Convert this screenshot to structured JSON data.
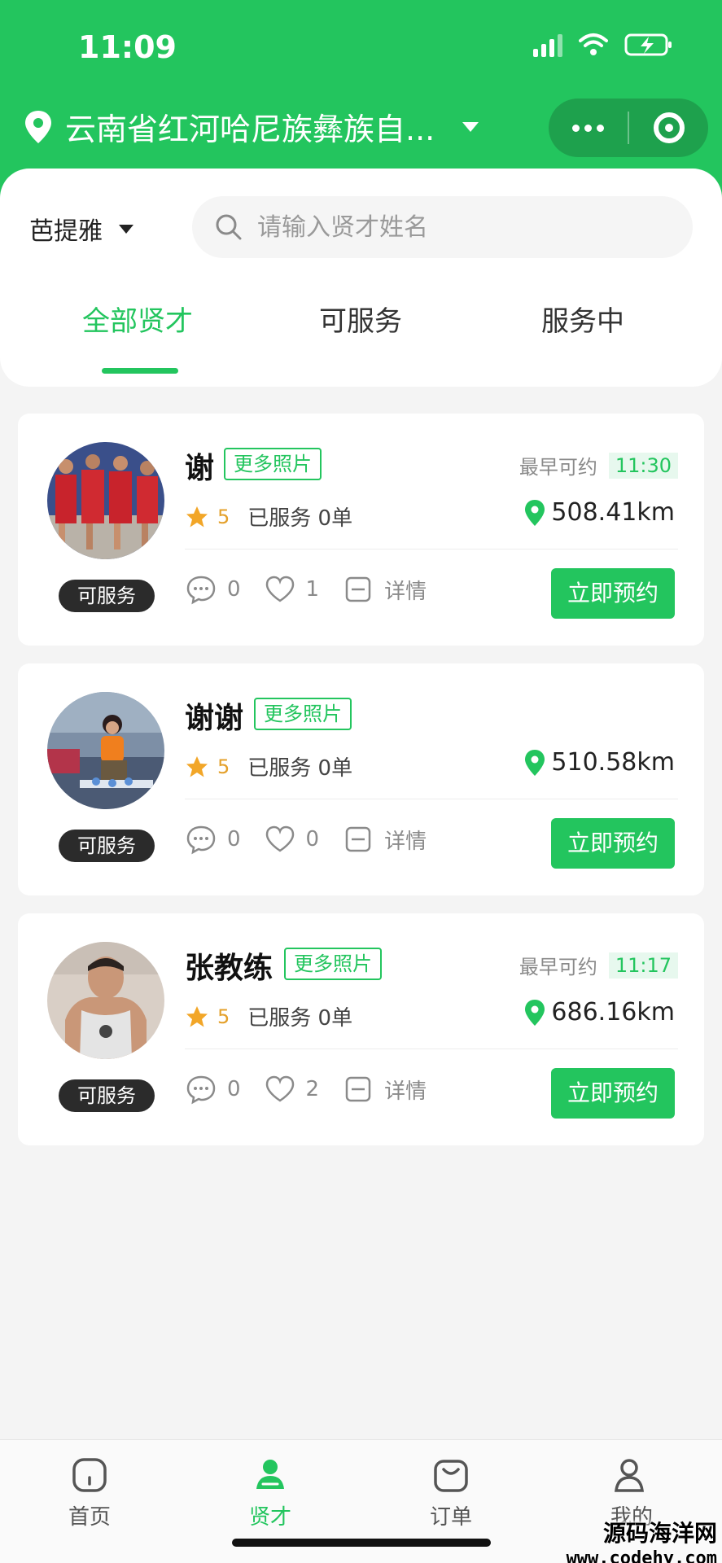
{
  "status_bar": {
    "time": "11:09"
  },
  "header": {
    "location": "云南省红河哈尼族彝族自...",
    "capsule": {
      "more_icon": "more-dots-icon",
      "target_icon": "target-icon"
    }
  },
  "filter": {
    "city": "芭提雅",
    "search_placeholder": "请输入贤才姓名"
  },
  "tabs": [
    {
      "label": "全部贤才",
      "active": true
    },
    {
      "label": "可服务",
      "active": false
    },
    {
      "label": "服务中",
      "active": false
    }
  ],
  "cards": [
    {
      "name": "谢",
      "photos_label": "更多照片",
      "earliest_label": "最早可约",
      "earliest_time": "11:30",
      "rating": "5",
      "served": "已服务 0单",
      "distance": "508.41km",
      "status": "可服务",
      "comments": "0",
      "likes": "1",
      "details": "详情",
      "book": "立即预约"
    },
    {
      "name": "谢谢",
      "photos_label": "更多照片",
      "earliest_label": "",
      "earliest_time": "",
      "rating": "5",
      "served": "已服务 0单",
      "distance": "510.58km",
      "status": "可服务",
      "comments": "0",
      "likes": "0",
      "details": "详情",
      "book": "立即预约"
    },
    {
      "name": "张教练",
      "photos_label": "更多照片",
      "earliest_label": "最早可约",
      "earliest_time": "11:17",
      "rating": "5",
      "served": "已服务 0单",
      "distance": "686.16km",
      "status": "可服务",
      "comments": "0",
      "likes": "2",
      "details": "详情",
      "book": "立即预约"
    }
  ],
  "bottom_nav": [
    {
      "label": "首页",
      "icon": "home-icon",
      "active": false
    },
    {
      "label": "贤才",
      "icon": "person-icon",
      "active": true
    },
    {
      "label": "订单",
      "icon": "bag-icon",
      "active": false
    },
    {
      "label": "我的",
      "icon": "profile-icon",
      "active": false
    }
  ],
  "watermark": {
    "line1": "源码海洋网",
    "line2": "www.codehy.com"
  },
  "colors": {
    "brand": "#23c55e",
    "badge_dark": "#2b2b2b",
    "star": "#e4a02a"
  }
}
